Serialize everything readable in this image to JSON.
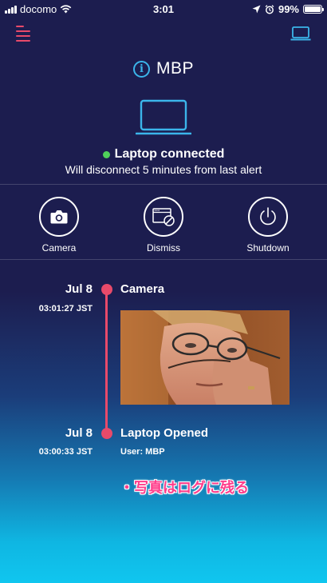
{
  "status_bar": {
    "carrier": "docomo",
    "time": "3:01",
    "battery": "99%",
    "battery_level": 0.99
  },
  "header": {
    "menu_icon": "hamburger-menu-icon",
    "device_icon": "laptop-icon"
  },
  "device": {
    "name": "MBP",
    "status": "Laptop connected",
    "status_color": "#4fd05a",
    "subtitle": "Will disconnect 5 minutes from last alert"
  },
  "actions": [
    {
      "label": "Camera",
      "icon": "camera-icon"
    },
    {
      "label": "Dismiss",
      "icon": "dismiss-window-icon"
    },
    {
      "label": "Shutdown",
      "icon": "power-icon"
    }
  ],
  "timeline": [
    {
      "date": "Jul 8",
      "time": "03:01:27 JST",
      "event": "Camera",
      "detail": ""
    },
    {
      "date": "Jul 8",
      "time": "03:00:33 JST",
      "event": "Laptop Opened",
      "detail": "User: MBP"
    }
  ],
  "annotation": "・写真はログに残る",
  "colors": {
    "accent": "#e84a6a",
    "icon_blue": "#3bb5ea",
    "background_top": "#1c1d4f",
    "background_bottom": "#10c6ef"
  }
}
